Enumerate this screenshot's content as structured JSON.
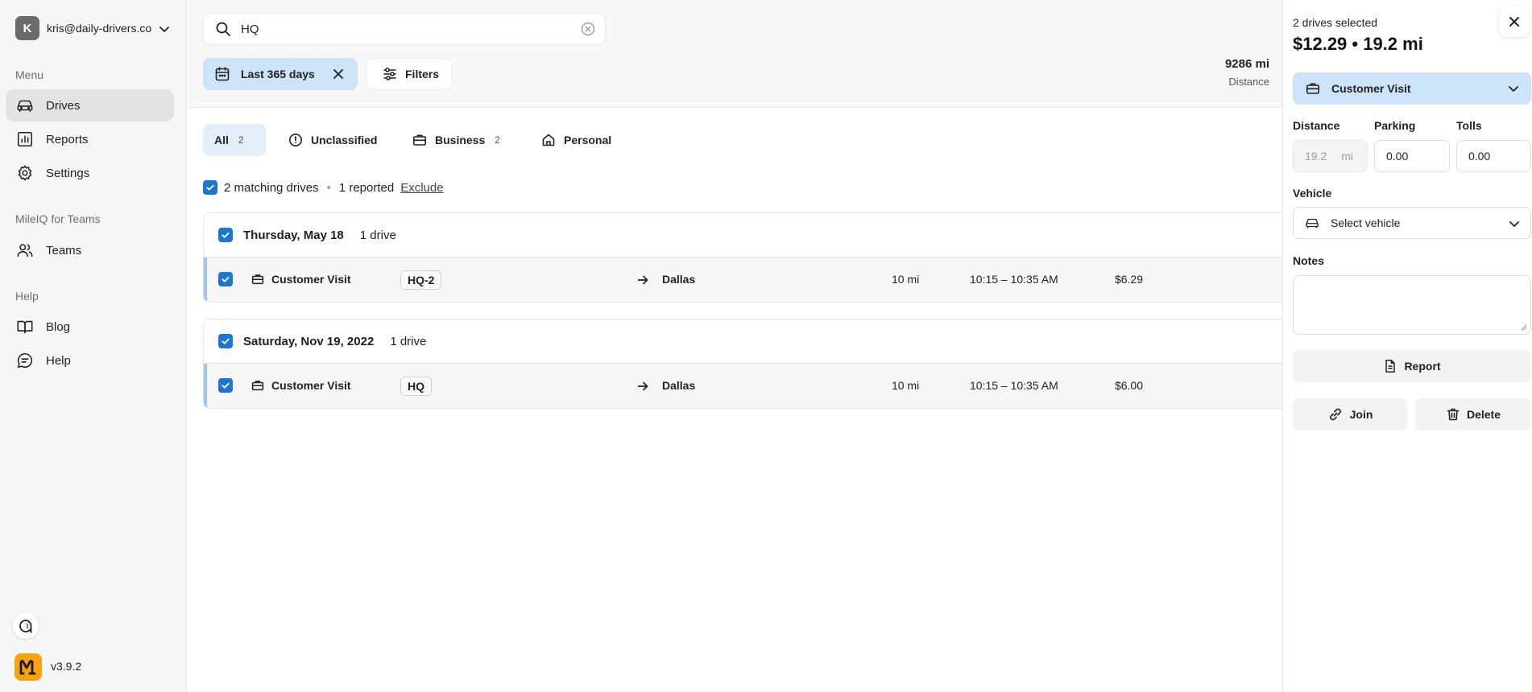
{
  "sidebar": {
    "account": {
      "initial": "K",
      "email": "kris@daily-drivers.co..."
    },
    "menu_heading": "Menu",
    "menu_items": [
      {
        "label": "Drives",
        "icon": "car-icon",
        "active": true
      },
      {
        "label": "Reports",
        "icon": "chart-icon",
        "active": false
      },
      {
        "label": "Settings",
        "icon": "gear-icon",
        "active": false
      }
    ],
    "teams_heading": "MileIQ for Teams",
    "teams_items": [
      {
        "label": "Teams",
        "icon": "people-icon"
      }
    ],
    "help_heading": "Help",
    "help_items": [
      {
        "label": "Blog",
        "icon": "book-icon"
      },
      {
        "label": "Help",
        "icon": "chat-icon"
      }
    ],
    "version": "v3.9.2"
  },
  "search": {
    "value": "HQ",
    "placeholder": "Search"
  },
  "filters": {
    "date_range_label": "Last 365 days",
    "filters_label": "Filters"
  },
  "stats": {
    "distance_value": "9286 mi",
    "distance_label": "Distance"
  },
  "tabs": [
    {
      "label": "All",
      "count": "2",
      "active": true
    },
    {
      "label": "Unclassified",
      "count": ""
    },
    {
      "label": "Business",
      "count": "2"
    },
    {
      "label": "Personal",
      "count": ""
    }
  ],
  "matching": {
    "label": "2 matching drives",
    "reported": "1 reported",
    "exclude_label": "Exclude"
  },
  "groups": [
    {
      "date": "Thursday, May 18",
      "count": "1 drive",
      "drives": [
        {
          "category": "Customer Visit",
          "tag": "HQ-2",
          "destination": "Dallas",
          "distance": "10 mi",
          "time": "10:15 – 10:35 AM",
          "amount": "$6.29"
        }
      ]
    },
    {
      "date": "Saturday, Nov 19, 2022",
      "count": "1 drive",
      "drives": [
        {
          "category": "Customer Visit",
          "tag": "HQ",
          "destination": "Dallas",
          "distance": "10 mi",
          "time": "10:15 – 10:35 AM",
          "amount": "$6.00"
        }
      ]
    }
  ],
  "panel": {
    "selected_label": "2 drives selected",
    "total": "$12.29 • 19.2 mi",
    "category": "Customer Visit",
    "distance_label": "Distance",
    "distance_value": "19.2",
    "distance_unit": "mi",
    "parking_label": "Parking",
    "parking_value": "0.00",
    "tolls_label": "Tolls",
    "tolls_value": "0.00",
    "vehicle_label": "Vehicle",
    "vehicle_placeholder": "Select vehicle",
    "notes_label": "Notes",
    "report_label": "Report",
    "join_label": "Join",
    "delete_label": "Delete"
  },
  "colors": {
    "accent_blue": "#1976d2",
    "chip_blue": "#cde3f8",
    "logo_orange": "#f7a30d",
    "row_accent": "#9cc5ee"
  }
}
